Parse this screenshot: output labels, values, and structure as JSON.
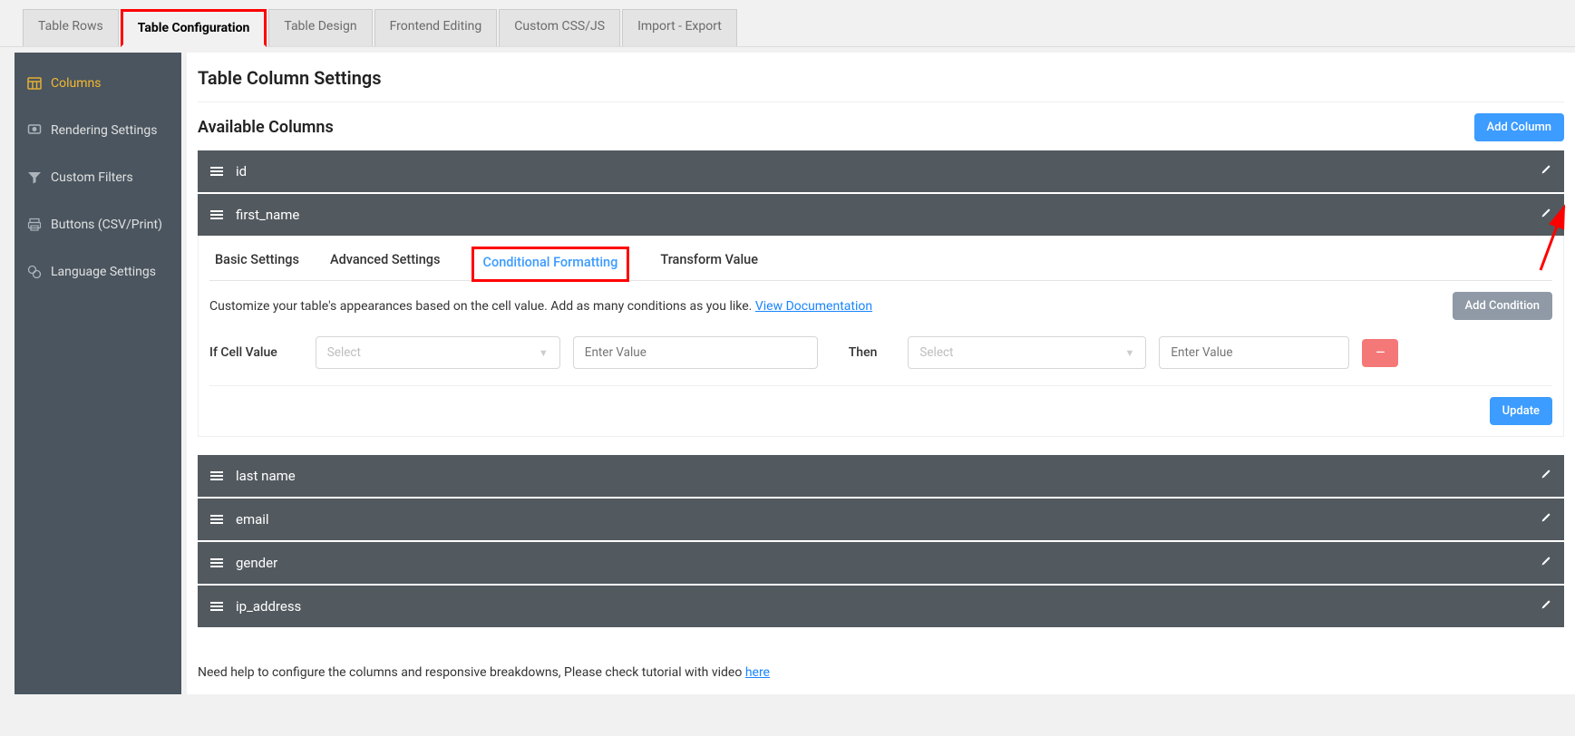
{
  "tabs": {
    "rows": "Table Rows",
    "config": "Table Configuration",
    "design": "Table Design",
    "frontend": "Frontend Editing",
    "css": "Custom CSS/JS",
    "import": "Import - Export"
  },
  "sidebar": {
    "columns": "Columns",
    "rendering": "Rendering Settings",
    "filters": "Custom Filters",
    "buttons": "Buttons (CSV/Print)",
    "language": "Language Settings"
  },
  "page_title": "Table Column Settings",
  "available_columns": "Available Columns",
  "add_column": "Add Column",
  "columns": {
    "id": "id",
    "first_name": "first_name",
    "last_name": "last name",
    "email": "email",
    "gender": "gender",
    "ip_address": "ip_address"
  },
  "subtabs": {
    "basic": "Basic Settings",
    "advanced": "Advanced Settings",
    "conditional": "Conditional Formatting",
    "transform": "Transform Value"
  },
  "cond": {
    "desc": "Customize your table's appearances based on the cell value. Add as many conditions as you like. ",
    "doc_link": "View Documentation",
    "add_btn": "Add Condition",
    "if_label": "If Cell Value",
    "then_label": "Then",
    "select_placeholder": "Select",
    "value_placeholder": "Enter Value",
    "remove": "—"
  },
  "update_btn": "Update",
  "help": {
    "text": "Need help to configure the columns and responsive breakdowns, Please check tutorial with video ",
    "link": "here"
  }
}
